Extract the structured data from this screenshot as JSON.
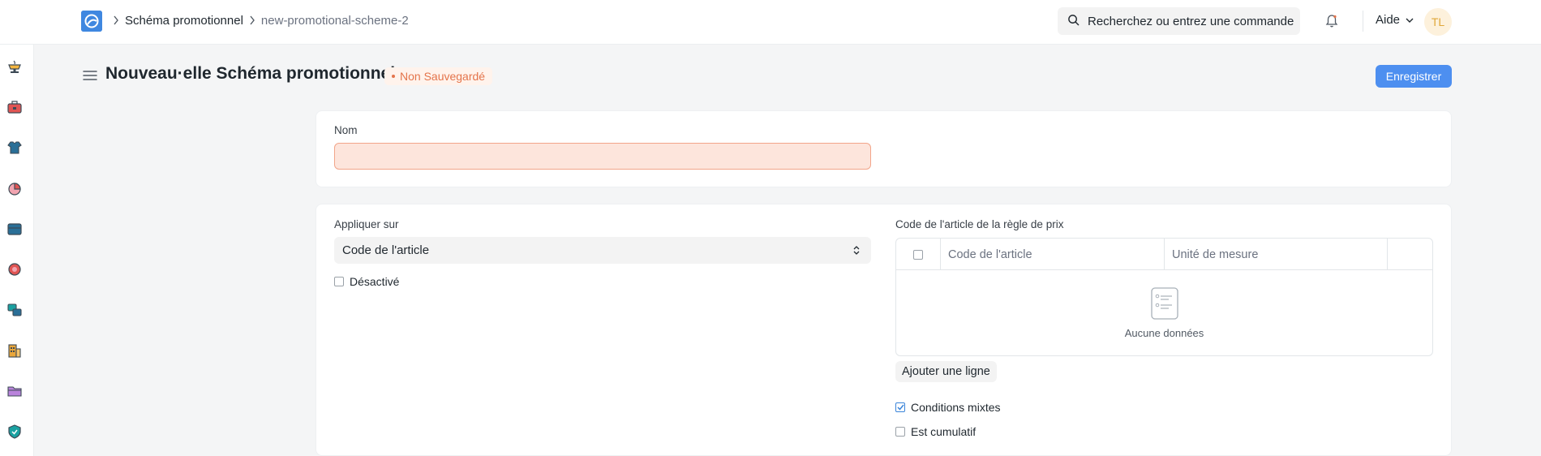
{
  "navbar": {
    "breadcrumbs": [
      "Schéma promotionnel",
      "new-promotional-scheme-2"
    ],
    "search_placeholder": "Recherchez ou entrez une commande",
    "help_label": "Aide",
    "avatar_initials": "TL"
  },
  "sidebar": {
    "icons": [
      "cup-icon",
      "toolbox-icon",
      "shirt-icon",
      "pie-chart-icon",
      "archive-box-icon",
      "support-icon",
      "transfer-icon",
      "building-icon",
      "folder-icon",
      "shield-icon"
    ]
  },
  "page": {
    "title": "Nouveau·elle Schéma promotionnel",
    "status": "Non Sauvegardé",
    "save_label": "Enregistrer"
  },
  "form": {
    "name_label": "Nom",
    "name_value": "",
    "apply_on_label": "Appliquer sur",
    "apply_on_value": "Code de l'article",
    "disabled_label": "Désactivé",
    "disabled_checked": false,
    "rule_table_label": "Code de l'article de la règle de prix",
    "rule_table_columns": [
      "Code de l'article",
      "Unité de mesure"
    ],
    "rule_table_empty": "Aucune données",
    "add_row_label": "Ajouter une ligne",
    "mixed_conditions_label": "Conditions mixtes",
    "mixed_conditions_checked": true,
    "cumulative_label": "Est cumulatif",
    "cumulative_checked": false
  },
  "colors": {
    "primary": "#4d8ff0",
    "status_text": "#e4744b",
    "status_bg": "#fff3ec",
    "error_input_bg": "#fde5dc",
    "error_input_border": "#f2a58a"
  }
}
